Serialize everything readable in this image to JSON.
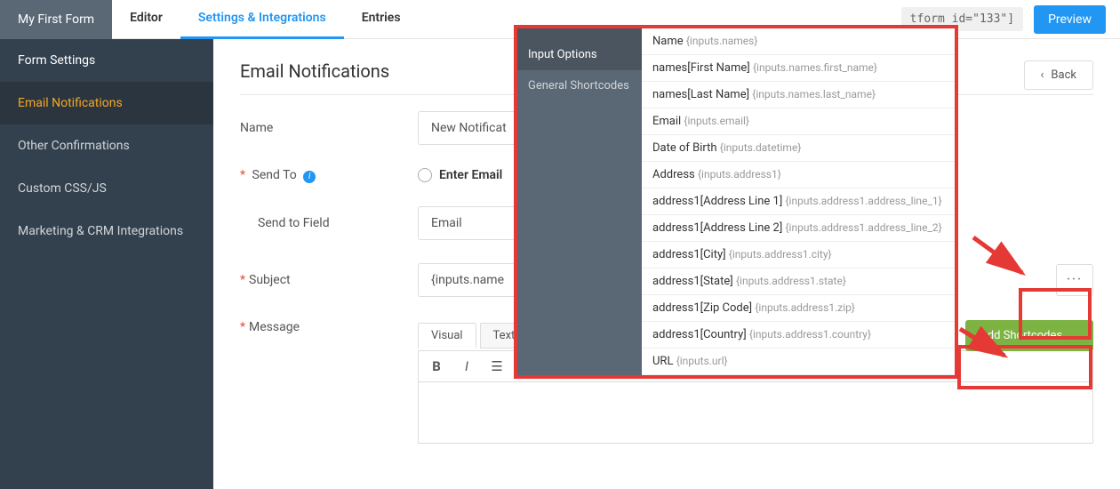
{
  "topbar": {
    "title": "My First Form",
    "tabs": [
      "Editor",
      "Settings & Integrations",
      "Entries"
    ],
    "active_tab": 1,
    "shortcode_tag": "tform id=\"133\"]",
    "preview": "Preview"
  },
  "sidebar": {
    "items": [
      "Form Settings",
      "Email Notifications",
      "Other Confirmations",
      "Custom CSS/JS",
      "Marketing & CRM Integrations"
    ],
    "active": 1
  },
  "page": {
    "title": "Email Notifications",
    "back": "Back"
  },
  "fields": {
    "name_label": "Name",
    "name_value": "New Notificat",
    "sendto_label": "Send To",
    "sendto_radio": "Enter Email",
    "sendto_field_label": "Send to Field",
    "sendto_field_value": "Email",
    "subject_label": "Subject",
    "subject_value": "{inputs.name",
    "message_label": "Message",
    "editor_tabs": [
      "Visual",
      "Text"
    ],
    "add_shortcodes": "Add Shortcodes"
  },
  "popup": {
    "left": [
      "Input Options",
      "General Shortcodes"
    ],
    "left_active": 0,
    "rows": [
      {
        "label": "Name",
        "code": "{inputs.names}"
      },
      {
        "label": "names[First Name]",
        "code": "{inputs.names.first_name}"
      },
      {
        "label": "names[Last Name]",
        "code": "{inputs.names.last_name}"
      },
      {
        "label": "Email",
        "code": "{inputs.email}"
      },
      {
        "label": "Date of Birth",
        "code": "{inputs.datetime}"
      },
      {
        "label": "Address",
        "code": "{inputs.address1}"
      },
      {
        "label": "address1[Address Line 1]",
        "code": "{inputs.address1.address_line_1}"
      },
      {
        "label": "address1[Address Line 2]",
        "code": "{inputs.address1.address_line_2}"
      },
      {
        "label": "address1[City]",
        "code": "{inputs.address1.city}"
      },
      {
        "label": "address1[State]",
        "code": "{inputs.address1.state}"
      },
      {
        "label": "address1[Zip Code]",
        "code": "{inputs.address1.zip}"
      },
      {
        "label": "address1[Country]",
        "code": "{inputs.address1.country}"
      },
      {
        "label": "URL",
        "code": "{inputs.url}"
      }
    ]
  },
  "colors": {
    "accent": "#2196f3",
    "sidebar_bg": "#33414e",
    "sidebar_active_text": "#f5a623",
    "green": "#7cb342",
    "highlight": "#e53935"
  }
}
